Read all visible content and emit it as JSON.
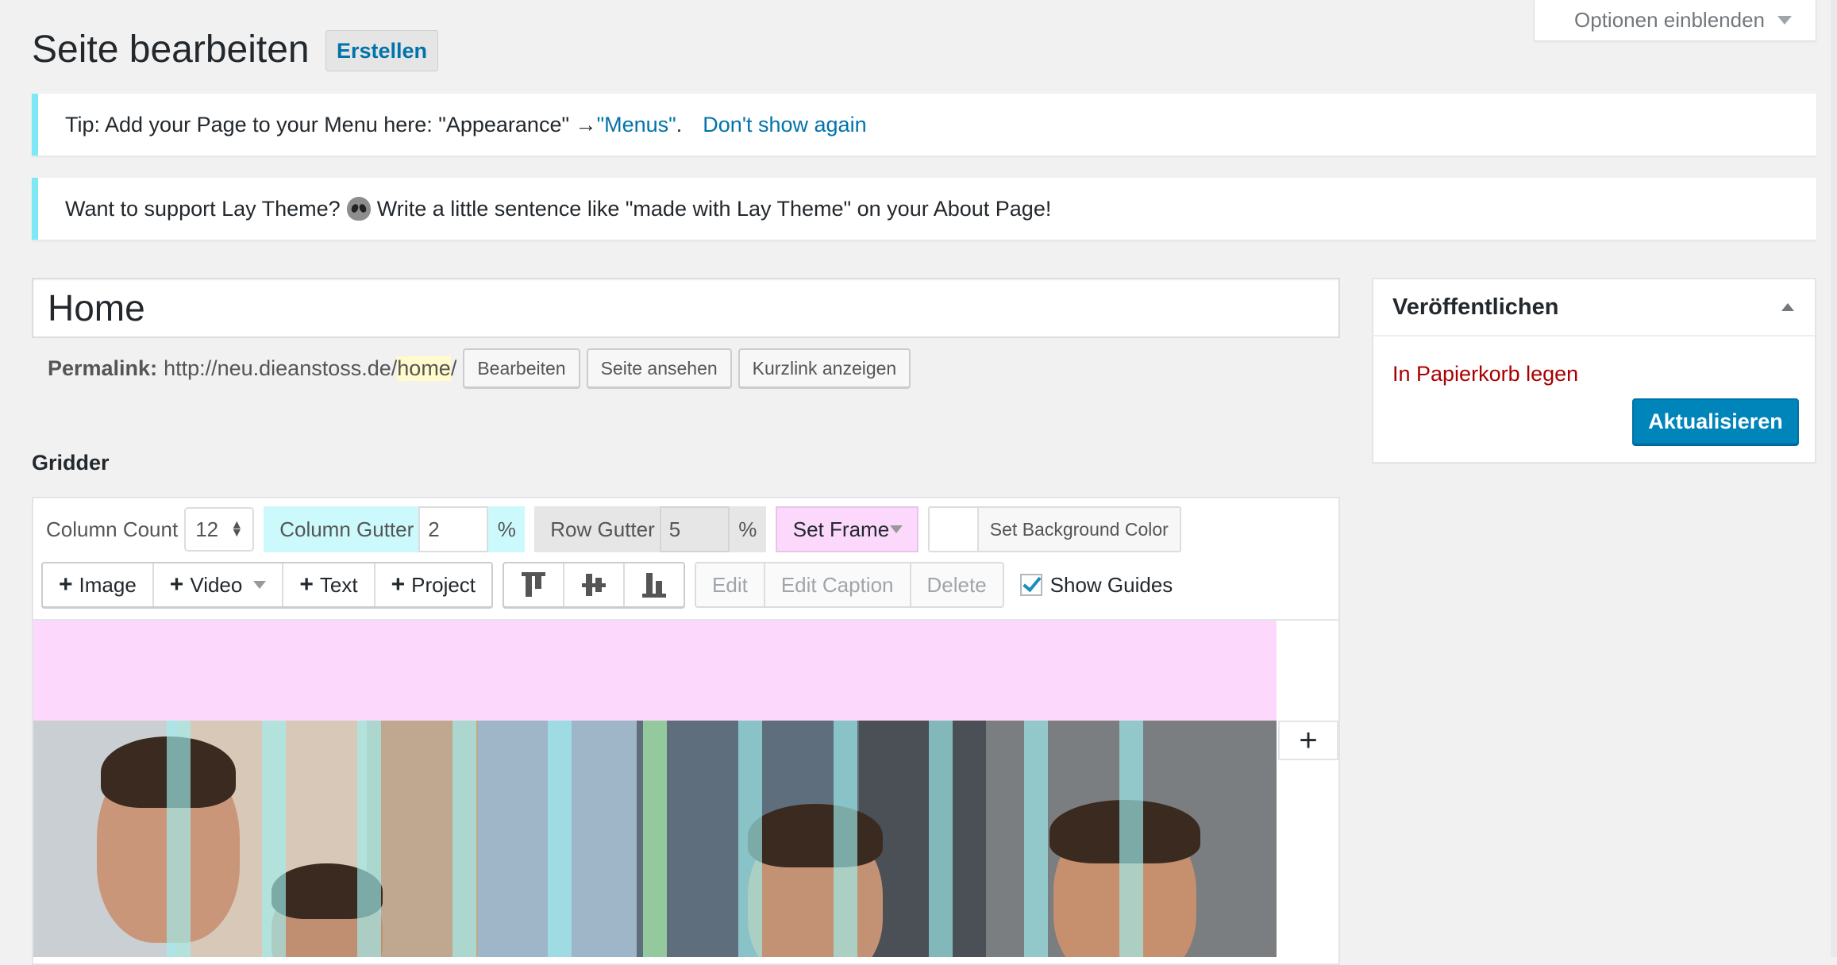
{
  "header": {
    "title": "Seite bearbeiten",
    "create_button": "Erstellen",
    "screen_options": "Optionen einblenden"
  },
  "notices": {
    "tip_text": "Tip: Add your Page to your Menu here: \"Appearance\" → ",
    "tip_menus_link": "\"Menus\"",
    "tip_period": ".",
    "tip_dismiss": "Don't show again",
    "support_before": "Want to support Lay Theme?",
    "support_after": "Write a little sentence like \"made with Lay Theme\" on your About Page!"
  },
  "post": {
    "title": "Home",
    "permalink_label": "Permalink:",
    "permalink_base": "http://neu.dieanstoss.de/",
    "permalink_slug": "home",
    "permalink_trailing": "/",
    "edit_button": "Bearbeiten",
    "view_button": "Seite ansehen",
    "shortlink_button": "Kurzlink anzeigen"
  },
  "gridder": {
    "label": "Gridder",
    "column_count_label": "Column Count",
    "column_count_value": "12",
    "column_gutter_label": "Column Gutter",
    "column_gutter_value": "2",
    "row_gutter_label": "Row Gutter",
    "row_gutter_value": "5",
    "percent": "%",
    "set_frame": "Set Frame",
    "set_background": "Set Background Color",
    "add_image": "Image",
    "add_video": "Video",
    "add_text": "Text",
    "add_project": "Project",
    "edit": "Edit",
    "edit_caption": "Edit Caption",
    "delete": "Delete",
    "show_guides": "Show Guides",
    "add_row": "+"
  },
  "publish": {
    "title": "Veröffentlichen",
    "trash": "In Papierkorb legen",
    "update": "Aktualisieren"
  },
  "colors": {
    "accent": "#0085ba",
    "frame_pink": "#fcd8fd",
    "gutter_cyan": "#ccfafc",
    "trash_red": "#aa0000"
  }
}
